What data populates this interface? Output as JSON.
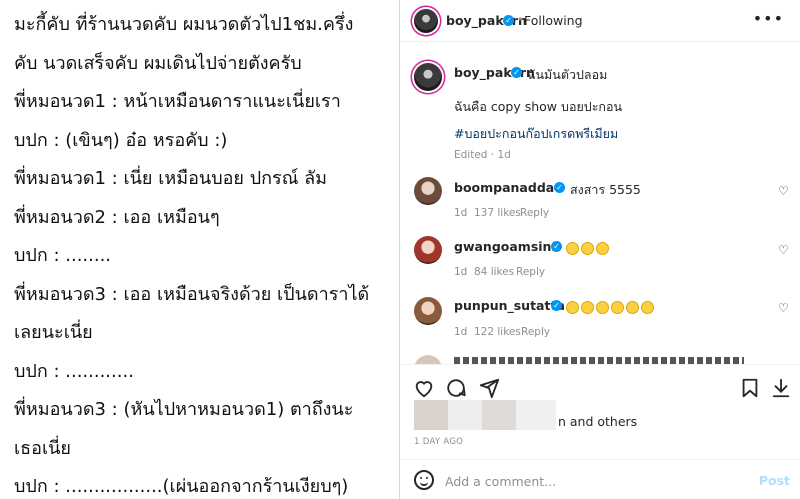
{
  "story": {
    "lines": [
      "มะกี้คับ ที่ร้านนวดคับ ผมนวดตัวไป1ชม.ครึ่ง",
      "คับ นวดเสร็จคับ ผมเดินไปจ่ายตังครับ",
      "พี่หมอนวด1 : หน้าเหมือนดาราแนะเนี่ยเรา",
      "บปก : (เขินๆ) อ๋อ หรอคับ :)",
      "พี่หมอนวด1 : เนี่ย เหมือนบอย ปกรณ์ ลัม",
      "พี่หมอนวด2 : เออ เหมือนๆ",
      "บปก : ........",
      "พี่หมอนวด3 : เออ เหมือนจริงด้วย เป็นดาราได้",
      "เลยนะเนี่ย",
      "บปก : ............",
      "พี่หมอนวด3 : (หันไปหาหมอนวด1) ตาถึงนะ",
      "เธอเนี่ย",
      "บปก : .................(เผ่นออกจากร้านเงียบๆ)"
    ]
  },
  "header": {
    "username": "boy_pakorn",
    "separator": "•",
    "follow_status": "Following",
    "more": "•••"
  },
  "caption": {
    "username": "boy_pakorn",
    "line1": "ฉันมันตัวปลอม",
    "line2": "ฉันคือ copy show บอยปะกอน",
    "hashtag": "#บอยปะกอนก๊อปเกรดพรีเมียม",
    "edited": "Edited · 1d"
  },
  "comments": [
    {
      "user": "boompanadda",
      "text": "สงสาร 5555",
      "emoji_count": 0,
      "age": "1d",
      "likes": "137 likes",
      "reply": "Reply"
    },
    {
      "user": "gwangoamsinn",
      "text": "",
      "emoji_count": 3,
      "age": "1d",
      "likes": "84 likes",
      "reply": "Reply"
    },
    {
      "user": "punpun_sutatta",
      "text": "",
      "emoji_count": 6,
      "age": "1d",
      "likes": "122 likes",
      "reply": "Reply"
    }
  ],
  "likes": {
    "text": "n and others"
  },
  "time_ago": "1 DAY AGO",
  "comment_box": {
    "placeholder": "Add a comment...",
    "post_label": "Post"
  },
  "colors": {
    "verified": "#0095f6",
    "hashtag": "#00376b",
    "muted": "#8e8e8e"
  }
}
